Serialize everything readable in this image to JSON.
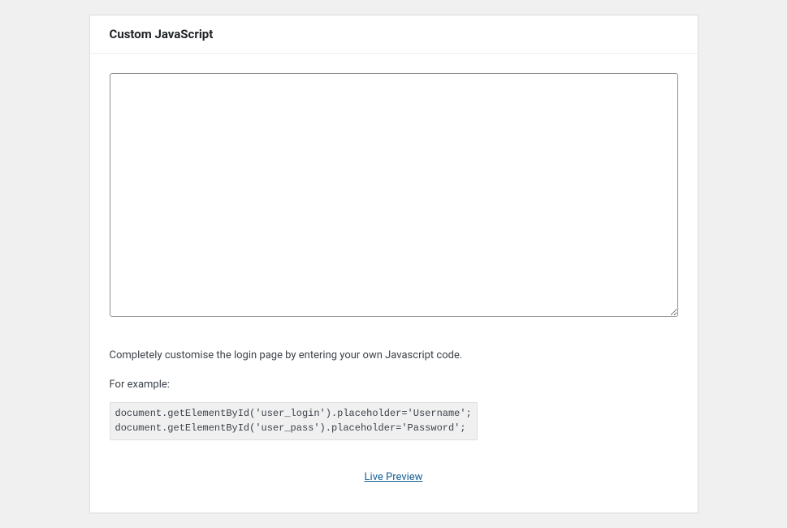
{
  "panel": {
    "title": "Custom JavaScript",
    "textarea": {
      "value": ""
    },
    "description": "Completely customise the login page by entering your own Javascript code.",
    "example_label": "For example:",
    "example_code": "document.getElementById('user_login').placeholder='Username';\ndocument.getElementById('user_pass').placeholder='Password';",
    "preview_link": "Live Preview"
  }
}
